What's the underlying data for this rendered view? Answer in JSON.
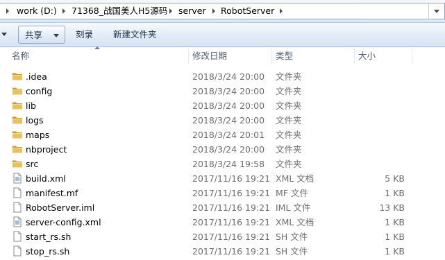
{
  "address": {
    "breadcrumbs": [
      "work (D:)",
      "71368_战国美人H5源码",
      "server",
      "RobotServer"
    ]
  },
  "toolbar": {
    "share_label": "共享",
    "burn_label": "刻录",
    "new_folder_label": "新建文件夹"
  },
  "columns": {
    "name": "名称",
    "date": "修改日期",
    "type": "类型",
    "size": "大小"
  },
  "files": [
    {
      "name": ".idea",
      "date": "2018/3/24 20:00",
      "type": "文件夹",
      "size": "",
      "icon": "folder-icon"
    },
    {
      "name": "config",
      "date": "2018/3/24 20:00",
      "type": "文件夹",
      "size": "",
      "icon": "folder-icon"
    },
    {
      "name": "lib",
      "date": "2018/3/24 20:00",
      "type": "文件夹",
      "size": "",
      "icon": "folder-icon"
    },
    {
      "name": "logs",
      "date": "2018/3/24 20:00",
      "type": "文件夹",
      "size": "",
      "icon": "folder-icon"
    },
    {
      "name": "maps",
      "date": "2018/3/24 20:01",
      "type": "文件夹",
      "size": "",
      "icon": "folder-icon"
    },
    {
      "name": "nbproject",
      "date": "2018/3/24 20:00",
      "type": "文件夹",
      "size": "",
      "icon": "folder-icon"
    },
    {
      "name": "src",
      "date": "2018/3/24 19:58",
      "type": "文件夹",
      "size": "",
      "icon": "folder-icon"
    },
    {
      "name": "build.xml",
      "date": "2017/11/16 19:21",
      "type": "XML 文档",
      "size": "5 KB",
      "icon": "xml-file-icon"
    },
    {
      "name": "manifest.mf",
      "date": "2017/11/16 19:21",
      "type": "MF 文件",
      "size": "1 KB",
      "icon": "file-icon"
    },
    {
      "name": "RobotServer.iml",
      "date": "2017/11/16 19:21",
      "type": "IML 文件",
      "size": "13 KB",
      "icon": "file-icon"
    },
    {
      "name": "server-config.xml",
      "date": "2017/11/16 19:21",
      "type": "XML 文档",
      "size": "1 KB",
      "icon": "xml-file-icon"
    },
    {
      "name": "start_rs.sh",
      "date": "2017/11/16 19:21",
      "type": "SH 文件",
      "size": "1 KB",
      "icon": "file-icon"
    },
    {
      "name": "stop_rs.sh",
      "date": "2017/11/16 19:21",
      "type": "SH 文件",
      "size": "1 KB",
      "icon": "file-icon"
    }
  ],
  "colors": {
    "folder": "#e8c15a",
    "folder_dark": "#c99a2e",
    "muted_text": "#6d6d6d",
    "header_text": "#4c607a"
  }
}
